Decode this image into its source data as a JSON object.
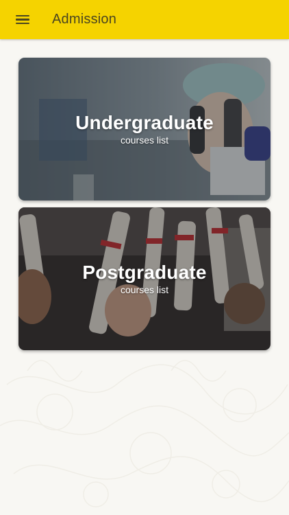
{
  "appbar": {
    "title": "Admission",
    "menu_icon": "hamburger-menu-icon",
    "background": "#f5d300"
  },
  "cards": [
    {
      "title": "Undergraduate",
      "subtitle": "courses list",
      "image": "lab-scientist-microscope-photo"
    },
    {
      "title": "Postgraduate",
      "subtitle": "courses list",
      "image": "graduation-diplomas-photo"
    }
  ]
}
